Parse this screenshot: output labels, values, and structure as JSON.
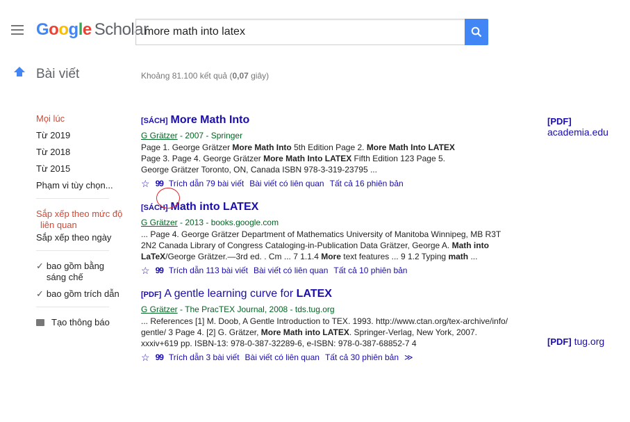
{
  "header": {
    "logo_google": "Google",
    "logo_scholar": "Scholar",
    "search_value": "more math into latex",
    "search_icon": "search-icon"
  },
  "section": {
    "title": "Bài viết",
    "stats_prefix": "Khoảng 81.100 kết quả (",
    "stats_time": "0,07",
    "stats_suffix": " giây)"
  },
  "sidebar": {
    "time_items": [
      "Mọi lúc",
      "Từ 2019",
      "Từ 2018",
      "Từ 2015",
      "Phạm vi tùy chọn..."
    ],
    "sort_relevance_1": "Sắp xếp theo mức độ",
    "sort_relevance_2": "liên quan",
    "sort_date": "Sắp xếp theo ngày",
    "include_patents_1": "bao gồm bằng",
    "include_patents_2": "sáng chế",
    "include_citations": "bao gồm trích dẫn",
    "create_alert": "Tạo thông báo"
  },
  "results": [
    {
      "tag": "[SÁCH]",
      "title": "More Math Into",
      "author": "G Grätzer",
      "source": " - 2007 - Springer",
      "snippet_lines": [
        "Page 1. George Grätzer More Math Into 5th Edition Page 2. More Math Into LATEX",
        "Page 3. Page 4. George Grätzer More Math Into LATEX Fifth Edition 123 Page 5.",
        "George Grätzer Toronto, ON, Canada ISBN 978-3-319-23795 ..."
      ],
      "cited": "Trích dẫn 79 bài viết",
      "related": "Bài viết có liên quan",
      "versions": "Tất cả 16 phiên bản",
      "side_tag": "[PDF]",
      "side_link": "academia.edu"
    },
    {
      "tag": "[SÁCH]",
      "title": "Math into LATEX",
      "author": "G Grätzer",
      "source": " - 2013 - books.google.com",
      "snippet_lines": [
        "... Page 4. George Grätzer Department of Mathematics University of Manitoba Winnipeg, MB R3T",
        "2N2 Canada Library of Congress Cataloging-in-Publication Data Grätzer, George A. Math into",
        "LaTeX/George Grätzer.—3rd ed. . Cm ... 7 1.1.4 More text features ... 9 1.2 Typing math ..."
      ],
      "cited": "Trích dẫn 113 bài viết",
      "related": "Bài viết có liên quan",
      "versions": "Tất cả 10 phiên bản"
    },
    {
      "tag": "[PDF]",
      "title_pre": "A gentle learning curve for ",
      "title": "LATEX",
      "author": "G Grätzer",
      "source": " - The PracTEX Journal, 2008 - tds.tug.org",
      "snippet_lines": [
        "... References [1] M. Doob, A Gentle Introduction to TEX. 1993. http://www.ctan.org/tex-archive/info/",
        "gentle/ 3 Page 4. [2] G. Grätzer, More Math into LATEX. Springer-Verlag, New York, 2007.",
        "xxxiv+619 pp. ISBN-13: 978-0-387-32289-6, e-ISBN: 978-0-387-68852-7 4"
      ],
      "cited": "Trích dẫn 3 bài viết",
      "related": "Bài viết có liên quan",
      "versions": "Tất cả 30 phiên bản",
      "more": "≫",
      "side_tag": "[PDF]",
      "side_link": "tug.org"
    }
  ],
  "colors": {
    "link": "#1a0dab",
    "green": "#006621",
    "red_active": "#d14836",
    "search_blue": "#4285f4"
  }
}
